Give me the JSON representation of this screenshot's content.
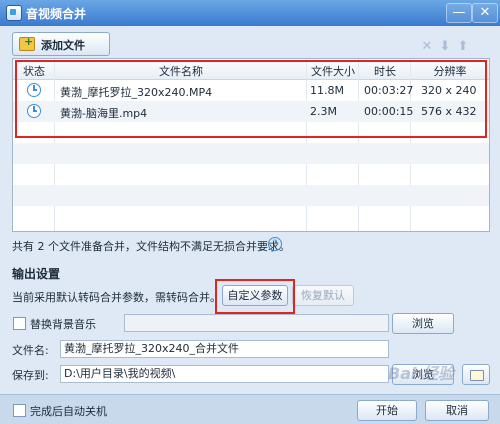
{
  "window": {
    "title": "音视频合并",
    "minimize": "—",
    "close": "✕"
  },
  "toolbar": {
    "add_label": "添加文件",
    "icons": [
      "delete-icon",
      "move-down-icon",
      "move-up-icon"
    ]
  },
  "table": {
    "columns": [
      "状态",
      "文件名称",
      "文件大小",
      "时长",
      "分辨率"
    ],
    "rows": [
      {
        "name": "黄渤_摩托罗拉_320x240.MP4",
        "size": "11.8M",
        "duration": "00:03:27",
        "resolution": "320 x 240"
      },
      {
        "name": "黄渤-脑海里.mp4",
        "size": "2.3M",
        "duration": "00:00:15",
        "resolution": "576 x 432"
      }
    ]
  },
  "summary": "共有 2 个文件准备合并，文件结构不满足无损合并要求。",
  "output": {
    "section_title": "输出设置",
    "params_text": "当前采用默认转码合并参数，需转码合并。",
    "custom_button": "自定义参数",
    "restore_button": "恢复默认",
    "bg_music_label": "替换背景音乐",
    "bg_music_value": "",
    "browse": "浏览",
    "filename_label": "文件名:",
    "filename_value": "黄渤_摩托罗拉_320x240_合并文件",
    "saveto_label": "保存到:",
    "saveto_value": "D:\\用户目录\\我的视频\\",
    "browse2": "浏览"
  },
  "footer": {
    "shutdown_label": "完成后自动关机",
    "start_button": "开始",
    "cancel_button": "取消"
  },
  "watermark": "Bai 经验",
  "colors": {
    "titlebar": "#3a7bd0",
    "highlight": "#e3231e",
    "background": "#dfe9f5"
  }
}
